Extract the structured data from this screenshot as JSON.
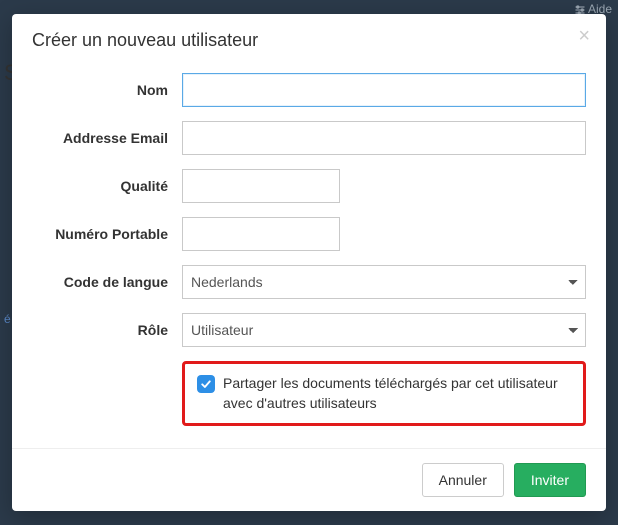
{
  "backdrop": {
    "help": "Aide",
    "letter": "S",
    "e": "é"
  },
  "modal": {
    "title": "Créer un nouveau utilisateur",
    "close": "×",
    "form": {
      "name": {
        "label": "Nom",
        "value": ""
      },
      "email": {
        "label": "Addresse Email",
        "value": ""
      },
      "quality": {
        "label": "Qualité",
        "value": ""
      },
      "mobile": {
        "label": "Numéro Portable",
        "value": ""
      },
      "language": {
        "label": "Code de langue",
        "selected": "Nederlands"
      },
      "role": {
        "label": "Rôle",
        "selected": "Utilisateur"
      },
      "share": {
        "checked": true,
        "label": "Partager les documents téléchargés par cet utilisateur avec d'autres utilisateurs"
      }
    },
    "footer": {
      "cancel": "Annuler",
      "invite": "Inviter"
    }
  }
}
